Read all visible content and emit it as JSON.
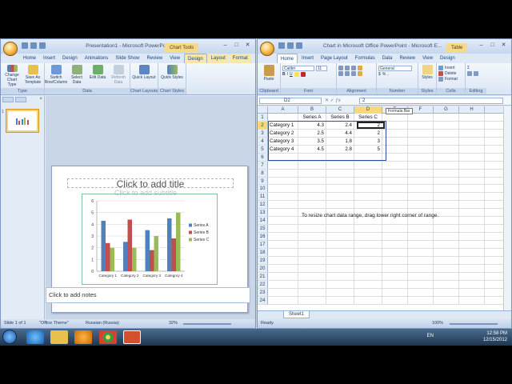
{
  "powerpoint": {
    "title": "Presentation1 - Microsoft PowerPo...",
    "context_tab": "Chart Tools",
    "tabs": [
      "Home",
      "Insert",
      "Design",
      "Animations",
      "Slide Show",
      "Review",
      "View",
      "Design",
      "Layout",
      "Format"
    ],
    "active_tab_index": 7,
    "ribbon": {
      "groups": [
        {
          "label": "Type",
          "buttons": [
            "Change Chart Type",
            "Save As Template"
          ]
        },
        {
          "label": "Data",
          "buttons": [
            "Switch Row/Column",
            "Select Data",
            "Edit Data",
            "Refresh Data"
          ]
        },
        {
          "label": "Chart Layouts",
          "buttons": [
            "Quick Layout"
          ]
        },
        {
          "label": "Chart Styles",
          "buttons": [
            "Quick Styles"
          ]
        }
      ]
    },
    "slide_number": "1",
    "title_placeholder": "Click to add title",
    "subtitle_placeholder": "Click to add subtitle",
    "notes_placeholder": "Click to add notes",
    "status": {
      "slide": "Slide 1 of 1",
      "theme": "\"Office Theme\"",
      "language": "Russian (Russia)",
      "zoom": "32%"
    }
  },
  "excel": {
    "title": "Chart in Microsoft Office PowerPoint - Microsoft E...",
    "context_tab": "Table",
    "tabs": [
      "Home",
      "Insert",
      "Page Layout",
      "Formulas",
      "Data",
      "Review",
      "View",
      "Design"
    ],
    "active_tab_index": 0,
    "ribbon": {
      "groups": [
        {
          "label": "Clipboard",
          "buttons": [
            "Paste"
          ]
        },
        {
          "label": "Font",
          "buttons": [
            "Calibri",
            "11"
          ]
        },
        {
          "label": "Alignment",
          "buttons": []
        },
        {
          "label": "Number",
          "buttons": [
            "General"
          ]
        },
        {
          "label": "Styles",
          "buttons": [
            "Styles"
          ]
        },
        {
          "label": "Cells",
          "buttons": [
            "Insert",
            "Delete",
            "Format"
          ]
        },
        {
          "label": "Editing",
          "buttons": [
            "Sort & Filter",
            "Find & Select"
          ]
        }
      ]
    },
    "name_box": "D2",
    "formula": "2",
    "formula_tooltip": "Formula Bar",
    "columns": [
      "A",
      "B",
      "C",
      "D",
      "E",
      "F",
      "G",
      "H"
    ],
    "rows": [
      [
        "",
        "Series A",
        "Series B",
        "Series C"
      ],
      [
        "Category 1",
        "4.3",
        "2.4",
        "2"
      ],
      [
        "Category 2",
        "2.5",
        "4.4",
        "2"
      ],
      [
        "Category 3",
        "3.5",
        "1.8",
        "3"
      ],
      [
        "Category 4",
        "4.5",
        "2.8",
        "5"
      ]
    ],
    "row_count": 24,
    "instruction": "To resize chart data range, drag lower right corner of range.",
    "sheet_tab": "Sheet1",
    "status": {
      "ready": "Ready",
      "zoom": "100%"
    }
  },
  "chart_data": {
    "type": "bar",
    "categories": [
      "Category 1",
      "Category 2",
      "Category 3",
      "Category 4"
    ],
    "series": [
      {
        "name": "Series A",
        "values": [
          4.3,
          2.5,
          3.5,
          4.5
        ],
        "color": "#4f81bd"
      },
      {
        "name": "Series B",
        "values": [
          2.4,
          4.4,
          1.8,
          2.8
        ],
        "color": "#c0504d"
      },
      {
        "name": "Series C",
        "values": [
          2,
          2,
          3,
          5
        ],
        "color": "#9bbb59"
      }
    ],
    "ylim": [
      0,
      6
    ],
    "yticks": [
      "0",
      "1",
      "2",
      "3",
      "4",
      "5",
      "6"
    ],
    "legend": "right"
  },
  "taskbar": {
    "time": "12:58 PM",
    "date": "12/15/2012",
    "lang": "EN"
  }
}
